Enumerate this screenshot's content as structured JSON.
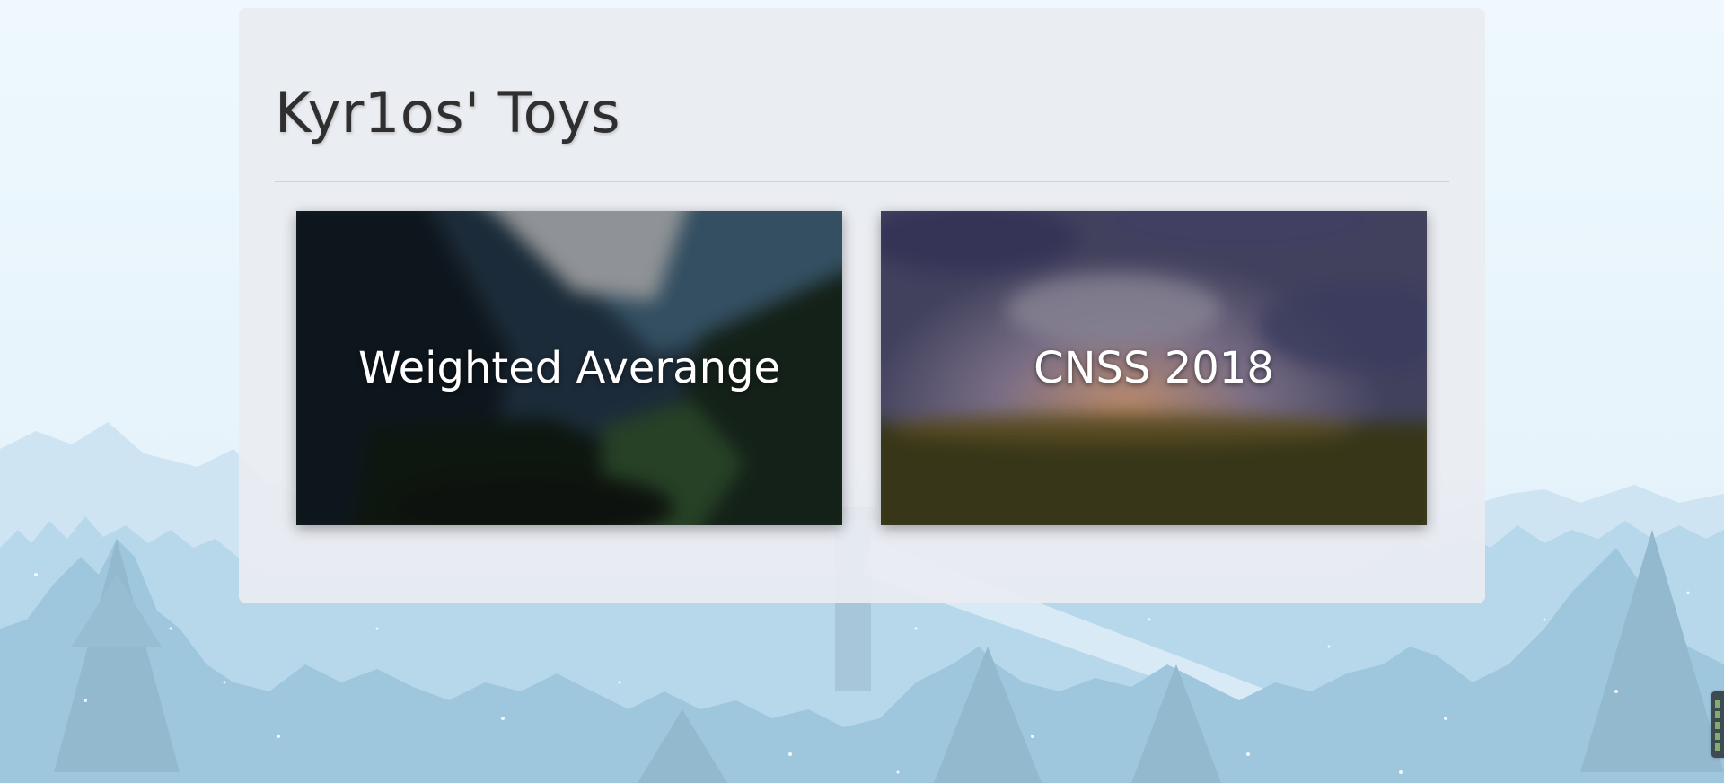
{
  "page": {
    "title": "Kyr1os' Toys"
  },
  "cards": [
    {
      "label": "Weighted Averange",
      "theme": "mountain-valley"
    },
    {
      "label": "CNSS 2018",
      "theme": "sunset-field"
    }
  ],
  "colors": {
    "sky": "#eaf6fd",
    "far_mountains": "#c2dcee",
    "trees": "#9bc4da",
    "panel": "#e9ecf1",
    "title_text": "#2f2f2f"
  }
}
